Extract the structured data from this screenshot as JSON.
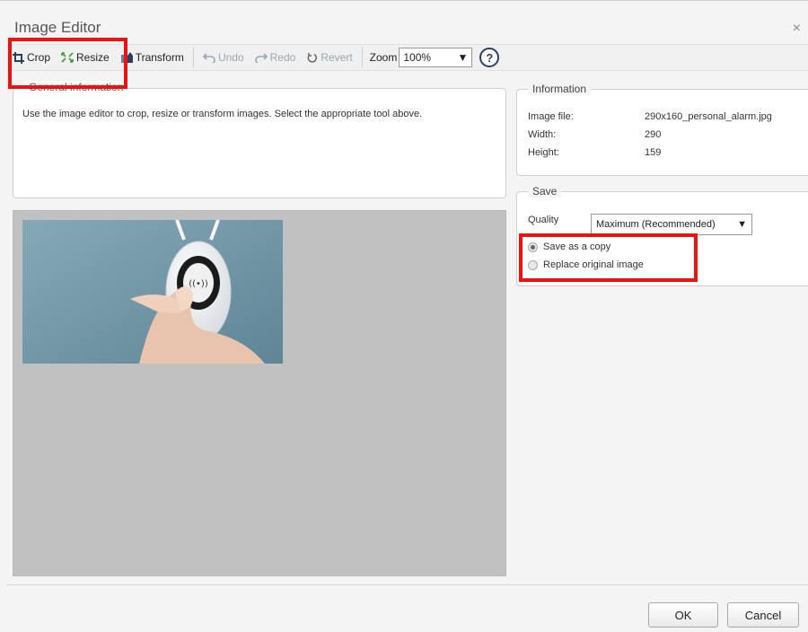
{
  "window": {
    "title": "Image Editor",
    "close_glyph": "×"
  },
  "toolbar": {
    "crop_label": "Crop",
    "resize_label": "Resize",
    "transform_label": "Transform",
    "undo_label": "Undo",
    "redo_label": "Redo",
    "revert_label": "Revert",
    "zoom_label": "Zoom",
    "zoom_value": "100%",
    "help_glyph": "?",
    "icons": [
      "crop-icon",
      "resize-icon",
      "transform-icon",
      "undo-icon",
      "redo-icon",
      "revert-icon",
      "help-icon"
    ]
  },
  "general": {
    "legend": "General information",
    "text": "Use the image editor to crop, resize or transform images. Select the appropriate tool above."
  },
  "info": {
    "legend": "Information",
    "image_file_label": "Image file:",
    "image_file_value": "290x160_personal_alarm.jpg",
    "width_label": "Width:",
    "width_value": "290",
    "height_label": "Height:",
    "height_value": "159"
  },
  "save": {
    "legend": "Save",
    "quality_label": "Quality",
    "quality_value": "Maximum (Recommended)",
    "options": [
      {
        "label": "Save as a copy",
        "checked": true
      },
      {
        "label": "Replace original image",
        "checked": false
      }
    ]
  },
  "footer": {
    "ok_label": "OK",
    "cancel_label": "Cancel"
  },
  "colors": {
    "highlight": "#ee1111",
    "canvas_bg": "#c1c1c1",
    "help_accent": "#2a3f66"
  }
}
